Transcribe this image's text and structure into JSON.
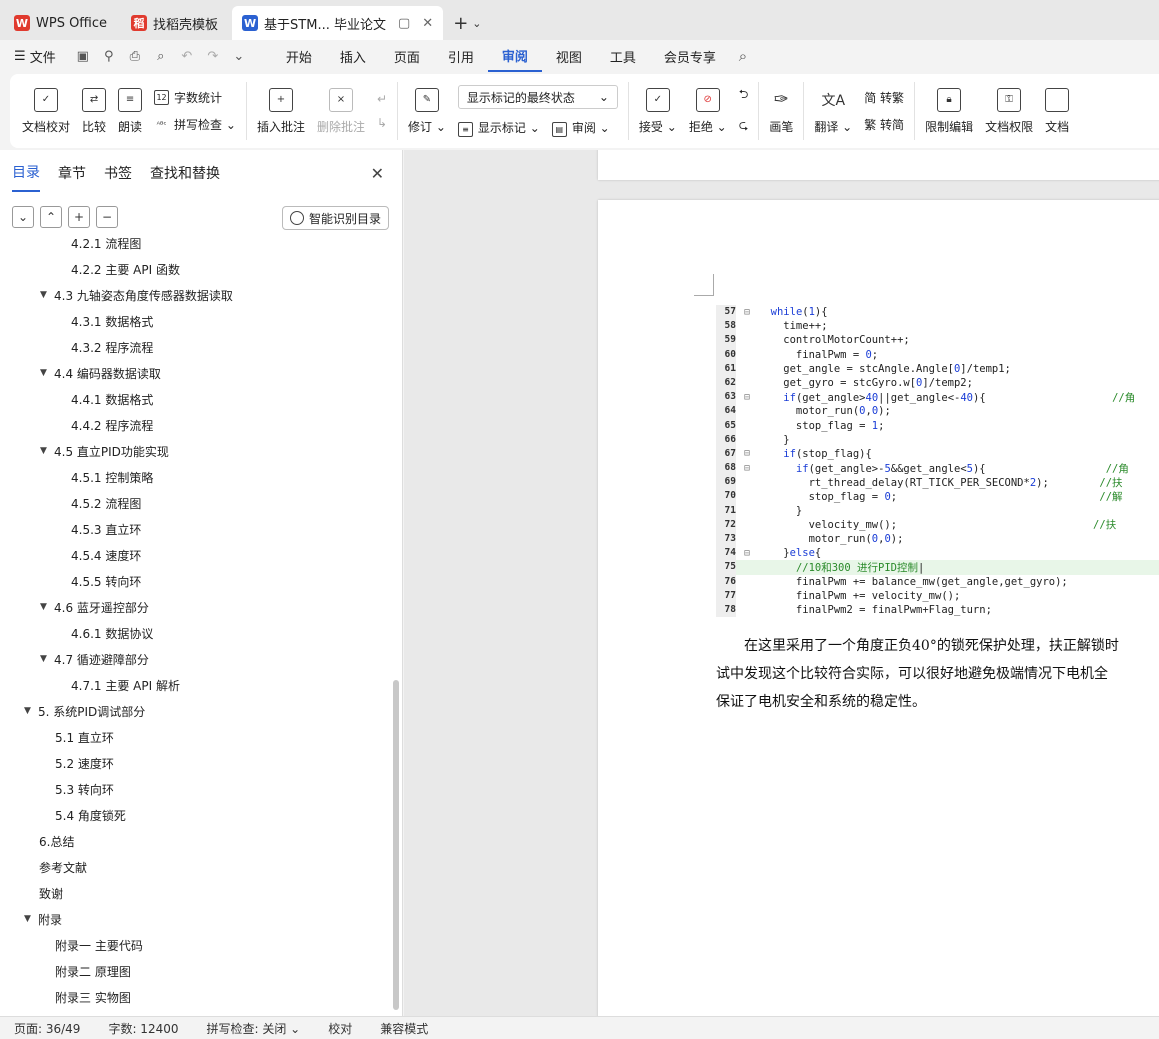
{
  "tabs": [
    {
      "label": "WPS Office",
      "logo_color": "#e03a2e",
      "logo_char": "W"
    },
    {
      "label": "找稻壳模板",
      "logo_color": "#e03a2e",
      "logo_char": "稻"
    },
    {
      "label": "基于STM... 毕业论文",
      "logo_color": "#2b61d1",
      "logo_char": "W",
      "active": true
    }
  ],
  "menu": {
    "file": "文件",
    "items": [
      "开始",
      "插入",
      "页面",
      "引用",
      "审阅",
      "视图",
      "工具",
      "会员专享"
    ],
    "active": "审阅"
  },
  "ribbon": {
    "doc_check": "文档校对",
    "compare": "比较",
    "read": "朗读",
    "word_count": "字数统计",
    "spell_check": "拼写检查",
    "insert_comment": "插入批注",
    "delete_comment": "删除批注",
    "revise": "修订",
    "markup_state": "显示标记的最终状态",
    "show_markup": "显示标记",
    "review": "审阅",
    "accept": "接受",
    "reject": "拒绝",
    "pen": "画笔",
    "translate": "翻译",
    "trad_simp": "简 转繁",
    "simp_trad": "繁 转简",
    "restrict_edit": "限制编辑",
    "doc_permission": "文档权限",
    "doc_more": "文档"
  },
  "panel": {
    "tabs": [
      "目录",
      "章节",
      "书签",
      "查找和替换"
    ],
    "smart_toc": "智能识别目录"
  },
  "toc": [
    {
      "indent": 2,
      "text": "4.2.1  流程图"
    },
    {
      "indent": 2,
      "text": "4.2.2  主要 API 函数"
    },
    {
      "indent": 1,
      "arrow": true,
      "text": "4.3    九轴姿态角度传感器数据读取"
    },
    {
      "indent": 2,
      "text": "4.3.1  数据格式"
    },
    {
      "indent": 2,
      "text": "4.3.2  程序流程"
    },
    {
      "indent": 1,
      "arrow": true,
      "text": "4.4  编码器数据读取"
    },
    {
      "indent": 2,
      "text": "4.4.1  数据格式"
    },
    {
      "indent": 2,
      "text": "4.4.2  程序流程"
    },
    {
      "indent": 1,
      "arrow": true,
      "text": "4.5  直立PID功能实现"
    },
    {
      "indent": 2,
      "text": "4.5.1  控制策略"
    },
    {
      "indent": 2,
      "text": "4.5.2  流程图"
    },
    {
      "indent": 2,
      "text": "4.5.3  直立环"
    },
    {
      "indent": 2,
      "text": "4.5.4  速度环"
    },
    {
      "indent": 2,
      "text": "4.5.5  转向环"
    },
    {
      "indent": 1,
      "arrow": true,
      "text": "4.6  蓝牙遥控部分"
    },
    {
      "indent": 2,
      "text": "4.6.1  数据协议"
    },
    {
      "indent": 1,
      "arrow": true,
      "text": "4.7  循迹避障部分"
    },
    {
      "indent": 2,
      "text": "4.7.1  主要 API 解析"
    },
    {
      "indent": 0,
      "arrow": true,
      "text": "5.  系统PID调试部分"
    },
    {
      "indent": 1,
      "text": "5.1  直立环"
    },
    {
      "indent": 1,
      "text": "5.2  速度环"
    },
    {
      "indent": 1,
      "text": "5.3  转向环"
    },
    {
      "indent": 1,
      "text": "5.4  角度锁死"
    },
    {
      "indent": 0,
      "text": "6.总结",
      "noarrowpad": true
    },
    {
      "indent": 0,
      "text": "参考文献",
      "noarrowpad": true
    },
    {
      "indent": 0,
      "text": "致谢",
      "noarrowpad": true
    },
    {
      "indent": 0,
      "arrow": true,
      "text": "附录"
    },
    {
      "indent": 1,
      "text": "附录一  主要代码"
    },
    {
      "indent": 1,
      "text": "附录二  原理图"
    },
    {
      "indent": 1,
      "text": "附录三  实物图"
    }
  ],
  "code": [
    {
      "ln": "57",
      "fold": "⊟",
      "html": "  <span class='kw'>while</span>(<span class='num'>1</span>){"
    },
    {
      "ln": "58",
      "fold": "",
      "html": "    time++;"
    },
    {
      "ln": "59",
      "fold": "",
      "html": "    controlMotorCount++;"
    },
    {
      "ln": "60",
      "fold": "",
      "html": "      finalPwm = <span class='num'>0</span>;"
    },
    {
      "ln": "61",
      "fold": "",
      "html": "    get_angle = stcAngle.Angle[<span class='num'>0</span>]/temp1;"
    },
    {
      "ln": "62",
      "fold": "",
      "html": "    get_gyro = stcGyro.w[<span class='num'>0</span>]/temp2;"
    },
    {
      "ln": "63",
      "fold": "⊟",
      "html": "    <span class='kw'>if</span>(get_angle><span class='num'>40</span>||get_angle<-<span class='num'>40</span>){                    <span class='cmt'>//角</span>"
    },
    {
      "ln": "64",
      "fold": "",
      "html": "      motor_run(<span class='num'>0</span>,<span class='num'>0</span>);"
    },
    {
      "ln": "65",
      "fold": "",
      "html": "      stop_flag = <span class='num'>1</span>;"
    },
    {
      "ln": "66",
      "fold": "",
      "html": "    }"
    },
    {
      "ln": "67",
      "fold": "⊟",
      "html": "    <span class='kw'>if</span>(stop_flag){"
    },
    {
      "ln": "68",
      "fold": "⊟",
      "html": "      <span class='kw'>if</span>(get_angle>-<span class='num'>5</span>&&get_angle<<span class='num'>5</span>){                   <span class='cmt'>//角</span>"
    },
    {
      "ln": "69",
      "fold": "",
      "html": "        rt_thread_delay(RT_TICK_PER_SECOND*<span class='num'>2</span>);        <span class='cmt'>//扶</span>"
    },
    {
      "ln": "70",
      "fold": "",
      "html": "        stop_flag = <span class='num'>0</span>;                                <span class='cmt'>//解</span>"
    },
    {
      "ln": "71",
      "fold": "",
      "html": "      }"
    },
    {
      "ln": "72",
      "fold": "",
      "html": "        velocity_mw();                               <span class='cmt'>//扶</span>"
    },
    {
      "ln": "73",
      "fold": "",
      "html": "        motor_run(<span class='num'>0</span>,<span class='num'>0</span>);"
    },
    {
      "ln": "74",
      "fold": "⊟",
      "html": "    }<span class='kw'>else</span>{"
    },
    {
      "ln": "75",
      "fold": "",
      "html": "      <span class='cmt'>//10和300 进行PID控制</span>|",
      "hl": true
    },
    {
      "ln": "76",
      "fold": "",
      "html": "      finalPwm += balance_mw(get_angle,get_gyro);"
    },
    {
      "ln": "77",
      "fold": "",
      "html": "      finalPwm += velocity_mw();"
    },
    {
      "ln": "78",
      "fold": "",
      "html": "      finalPwm2 = finalPwm+Flag_turn;"
    }
  ],
  "paragraph": [
    "　　在这里采用了一个角度正负40°的锁死保护处理，扶正解锁时",
    "试中发现这个比较符合实际，可以很好地避免极端情况下电机全",
    "保证了电机安全和系统的稳定性。"
  ],
  "status": {
    "page": "页面: 36/49",
    "words": "字数: 12400",
    "spell": "拼写检查: 关闭 ⌄",
    "proof": "校对",
    "compat": "兼容模式"
  }
}
